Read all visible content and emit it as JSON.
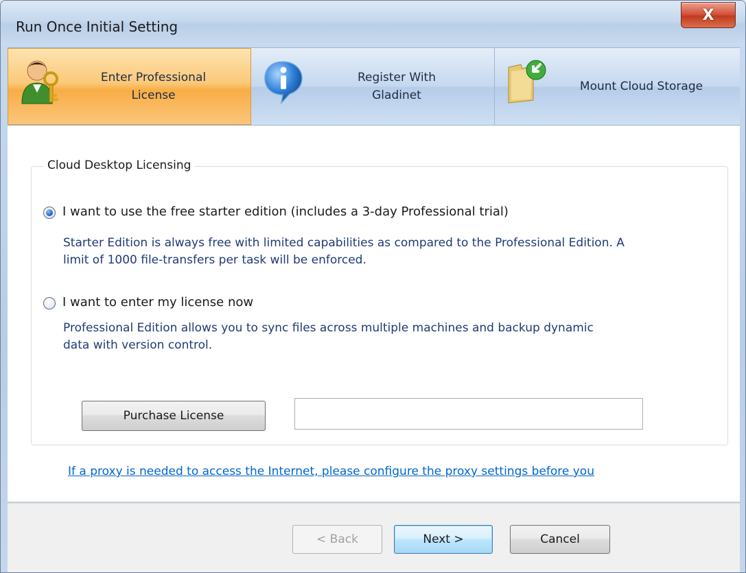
{
  "window": {
    "title": "Run Once Initial Setting",
    "close_glyph": "X"
  },
  "tabs": [
    {
      "label": "Enter Professional\nLicense",
      "icon": "user-key-icon",
      "active": true
    },
    {
      "label": "Register With\nGladinet",
      "icon": "info-icon",
      "active": false
    },
    {
      "label": "Mount Cloud Storage",
      "icon": "folder-arrow-icon",
      "active": false
    }
  ],
  "licensing": {
    "legend": "Cloud Desktop Licensing",
    "option_free": {
      "label": "I want to use the free starter edition (includes a 3-day Professional trial)",
      "description": "Starter Edition is always free with limited capabilities as compared to the Professional Edition. A limit of 1000 file-transfers per task will be enforced.",
      "checked": true
    },
    "option_license": {
      "label": "I want to enter my license now",
      "description": "Professional Edition allows you to sync files across multiple machines and backup dynamic data with version control.",
      "checked": false
    },
    "purchase_label": "Purchase License",
    "license_value": ""
  },
  "proxy_link": "If a proxy is needed to access the Internet, please configure the proxy settings before you",
  "footer": {
    "back_label": "< Back",
    "next_label": "Next >",
    "cancel_label": "Cancel"
  }
}
